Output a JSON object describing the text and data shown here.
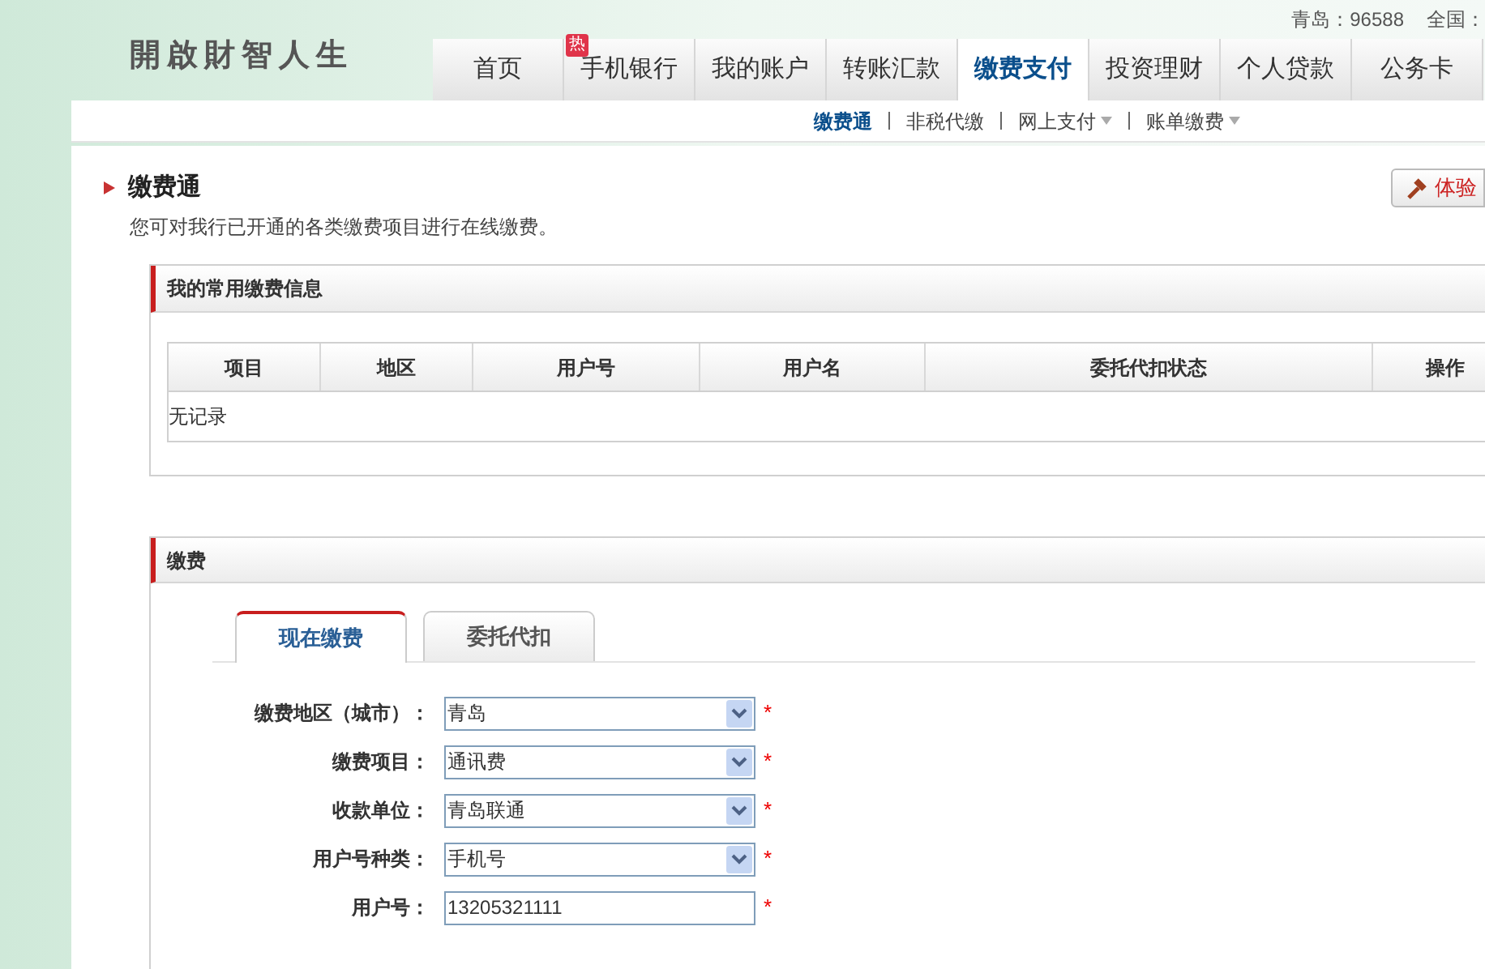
{
  "hotline": {
    "local": "青岛：96588",
    "national": "全国："
  },
  "logo": {
    "text": "開啟財智人生"
  },
  "nav": [
    {
      "label": "首页",
      "selected": false
    },
    {
      "label": "手机银行",
      "selected": false,
      "badge": "热"
    },
    {
      "label": "我的账户",
      "selected": false
    },
    {
      "label": "转账汇款",
      "selected": false
    },
    {
      "label": "缴费支付",
      "selected": true
    },
    {
      "label": "投资理财",
      "selected": false
    },
    {
      "label": "个人贷款",
      "selected": false
    },
    {
      "label": "公务卡",
      "selected": false
    }
  ],
  "subnav": [
    {
      "label": "缴费通",
      "selected": true,
      "dropdown": false
    },
    {
      "label": "非税代缴",
      "selected": false,
      "dropdown": false
    },
    {
      "label": "网上支付",
      "selected": false,
      "dropdown": true
    },
    {
      "label": "账单缴费",
      "selected": false,
      "dropdown": true
    }
  ],
  "page": {
    "title": "缴费通",
    "description": "您可对我行已开通的各类缴费项目进行在线缴费。",
    "trial_button": "体验"
  },
  "favorites": {
    "title": "我的常用缴费信息",
    "columns": [
      "项目",
      "地区",
      "用户号",
      "用户名",
      "委托代扣状态",
      "操作"
    ],
    "empty_text": "无记录"
  },
  "payment": {
    "title": "缴费",
    "tabs": [
      {
        "label": "现在缴费",
        "selected": true
      },
      {
        "label": "委托代扣",
        "selected": false
      }
    ],
    "fields": [
      {
        "kind": "select",
        "label": "缴费地区（城市）：",
        "value": "青岛",
        "required_mark": "*"
      },
      {
        "kind": "select",
        "label": "缴费项目：",
        "value": "通讯费",
        "required_mark": "*"
      },
      {
        "kind": "select",
        "label": "收款单位：",
        "value": "青岛联通",
        "required_mark": "*"
      },
      {
        "kind": "select",
        "label": "用户号种类：",
        "value": "手机号",
        "required_mark": "*"
      },
      {
        "kind": "input",
        "label": "用户号：",
        "value": "13205321111",
        "required_mark": "*"
      }
    ]
  }
}
